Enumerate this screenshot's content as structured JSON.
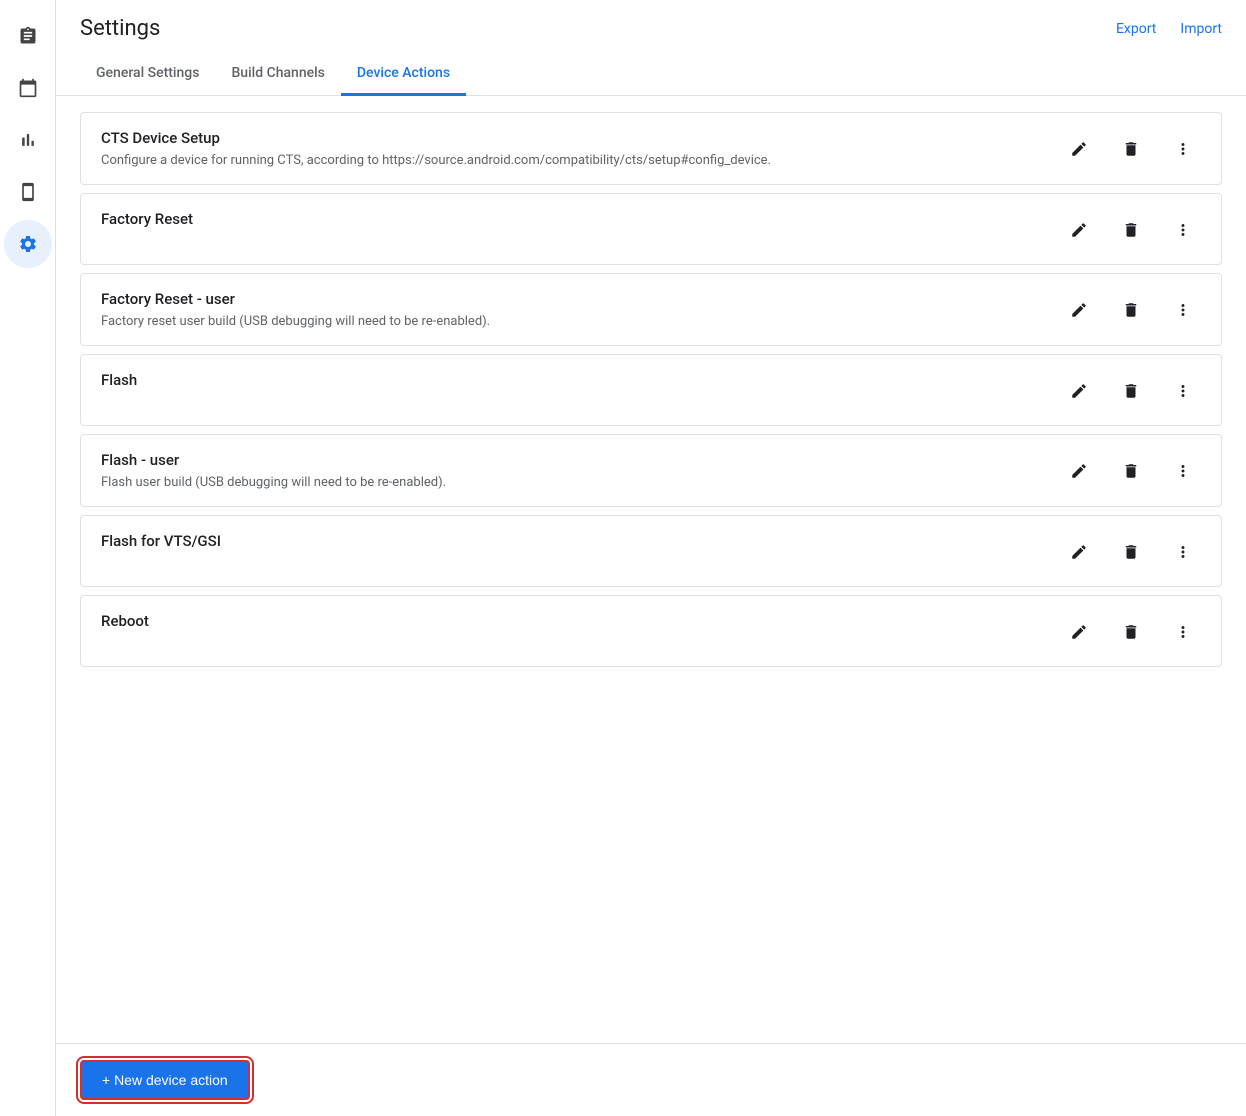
{
  "page": {
    "title": "Settings",
    "export_label": "Export",
    "import_label": "Import"
  },
  "sidebar": {
    "items": [
      {
        "name": "clipboard-icon",
        "symbol": "📋",
        "active": false
      },
      {
        "name": "calendar-icon",
        "symbol": "📅",
        "active": false
      },
      {
        "name": "chart-icon",
        "symbol": "📊",
        "active": false
      },
      {
        "name": "phone-icon",
        "symbol": "📱",
        "active": false
      },
      {
        "name": "settings-icon",
        "symbol": "⚙",
        "active": true
      }
    ]
  },
  "tabs": [
    {
      "label": "General Settings",
      "active": false
    },
    {
      "label": "Build Channels",
      "active": false
    },
    {
      "label": "Device Actions",
      "active": true
    }
  ],
  "actions": [
    {
      "title": "CTS Device Setup",
      "description": "Configure a device for running CTS, according to https://source.android.com/compatibility/cts/setup#config_device."
    },
    {
      "title": "Factory Reset",
      "description": ""
    },
    {
      "title": "Factory Reset - user",
      "description": "Factory reset user build (USB debugging will need to be re-enabled)."
    },
    {
      "title": "Flash",
      "description": ""
    },
    {
      "title": "Flash - user",
      "description": "Flash user build (USB debugging will need to be re-enabled)."
    },
    {
      "title": "Flash for VTS/GSI",
      "description": ""
    },
    {
      "title": "Reboot",
      "description": ""
    }
  ],
  "footer": {
    "new_action_label": "+ New device action"
  }
}
